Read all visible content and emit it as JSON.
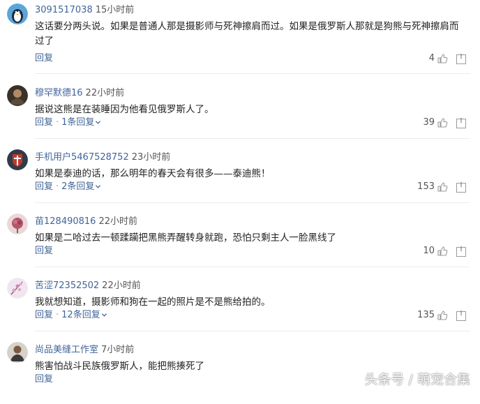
{
  "reply_label": "回复",
  "separator_dot": "·",
  "comments": [
    {
      "username": "3091517038",
      "time": "15小时前",
      "text": "这话要分两头说。如果是普通人那是摄影师与死神擦肩而过。如果是俄罗斯人那就是狗熊与死神擦肩而过了",
      "replies_label": "",
      "likes": "4"
    },
    {
      "username": "穆罕默德16",
      "time": "22小时前",
      "text": "据说这熊是在装睡因为他看见俄罗斯人了。",
      "replies_label": "1条回复",
      "likes": "39"
    },
    {
      "username": "手机用户5467528752",
      "time": "23小时前",
      "text": "如果是泰迪的话，那么明年的春天会有很多——泰迪熊！",
      "replies_label": "2条回复",
      "likes": "153"
    },
    {
      "username": "苗128490816",
      "time": "22小时前",
      "text": "如果是二哈过去一顿蹂躏把黑熊弄醒转身就跑，恐怕只剩主人一脸黑线了",
      "replies_label": "",
      "likes": "10"
    },
    {
      "username": "苦涩72352502",
      "time": "22小时前",
      "text": "我就想知道，摄影师和狗在一起的照片是不是熊给拍的。",
      "replies_label": "12条回复",
      "likes": "135"
    },
    {
      "username": "尚品美缝工作室",
      "time": "7小时前",
      "text": "熊害怕战斗民族俄罗斯人，能把熊揍死了",
      "replies_label": "",
      "likes": ""
    }
  ],
  "watermark": "头条号 / 萌宠合集",
  "colors": {
    "link": "#406599",
    "text": "#222222",
    "muted": "#555555",
    "separator": "#ececec"
  }
}
